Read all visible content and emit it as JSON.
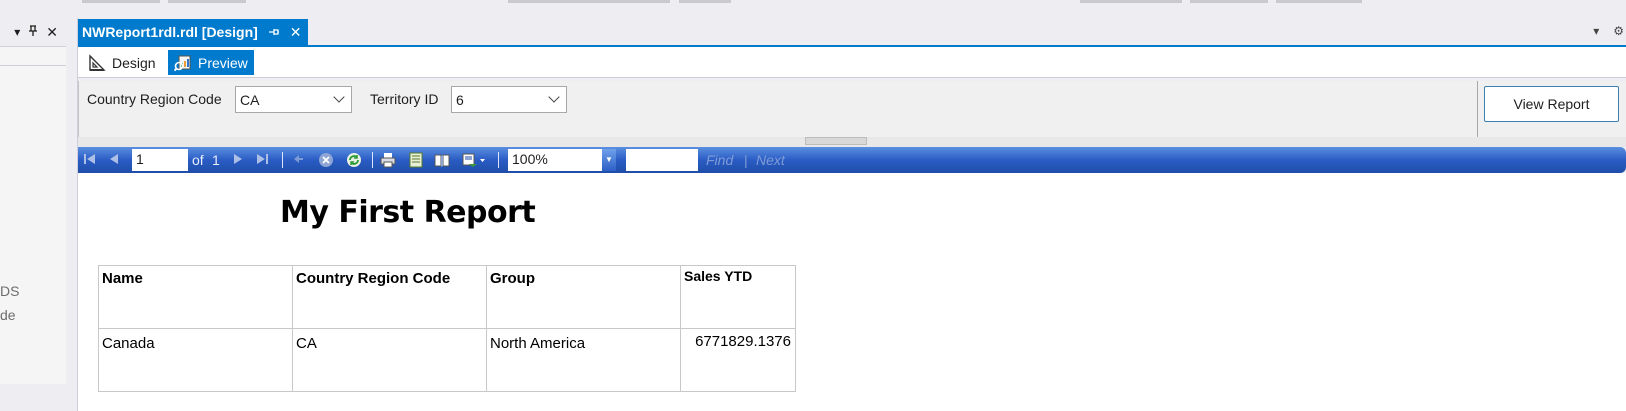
{
  "left_panel": {
    "dropdown_glyph": "▾",
    "pin_glyph": "⊥",
    "close_glyph": "✕",
    "partial_text_1": "DS",
    "partial_text_2": "de"
  },
  "tab": {
    "title": "NWReport1rdl.rdl [Design]",
    "pin_glyph": "⊣",
    "close_glyph": "✕"
  },
  "tab_row_right": {
    "dropdown_glyph": "▾",
    "settings_glyph": "⚙"
  },
  "modes": {
    "design_label": "Design",
    "preview_label": "Preview",
    "active": "Preview"
  },
  "parameters": {
    "country_label": "Country Region Code",
    "country_value": "CA",
    "territory_label": "Territory ID",
    "territory_value": "6",
    "view_report_label": "View Report"
  },
  "toolbar": {
    "current_page": "1",
    "of_label": "of",
    "total_pages": "1",
    "zoom": "100%",
    "find_label": "Find",
    "find_sep": "|",
    "next_label": "Next",
    "colors": {
      "bar_top": "#5a8fe0",
      "bar_bottom": "#1e4ea8"
    }
  },
  "report": {
    "title": "My First Report",
    "columns": [
      "Name",
      "Country Region Code",
      "Group",
      "Sales YTD"
    ],
    "rows": [
      [
        "Canada",
        "CA",
        "North America",
        "6771829.1376"
      ]
    ]
  },
  "colors": {
    "accent": "#007acc",
    "background": "#eeeef2"
  }
}
